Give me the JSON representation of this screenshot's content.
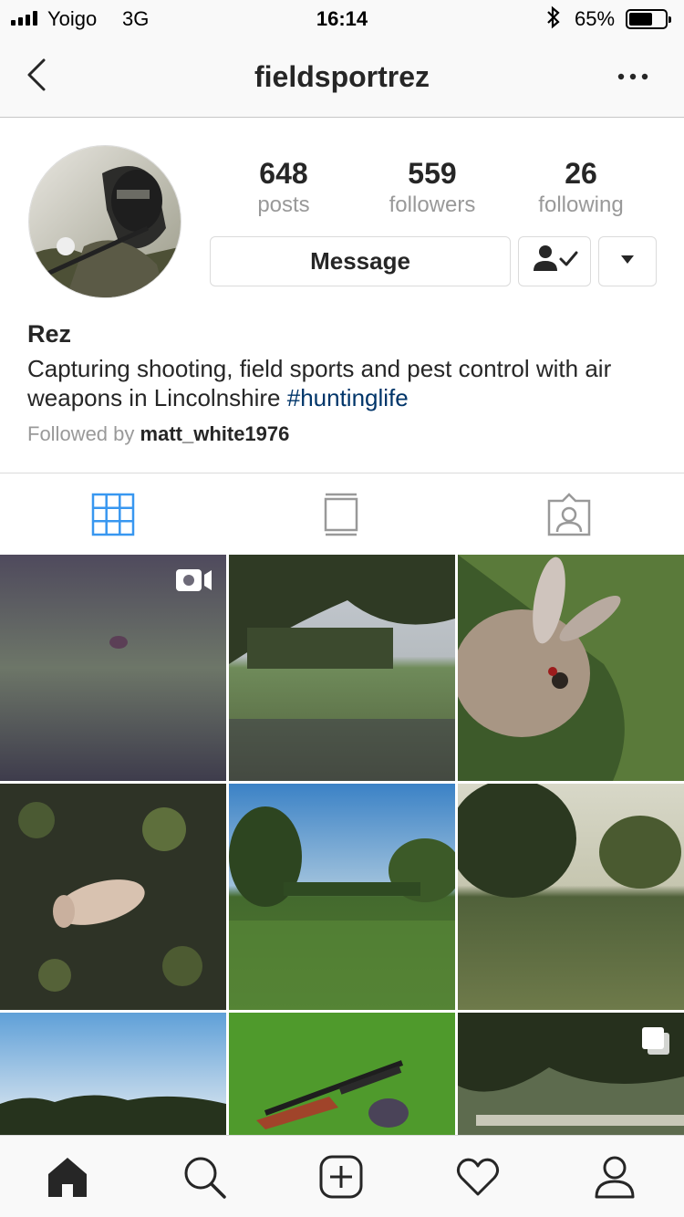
{
  "status_bar": {
    "carrier": "Yoigo",
    "network": "3G",
    "time": "16:14",
    "battery_percent": "65%",
    "battery_level": 0.65
  },
  "nav": {
    "title": "fieldsportrez",
    "back_icon": "chevron-left-icon",
    "more_icon": "more-horizontal-icon"
  },
  "profile": {
    "stats": [
      {
        "value": "648",
        "label": "posts"
      },
      {
        "value": "559",
        "label": "followers"
      },
      {
        "value": "26",
        "label": "following"
      }
    ],
    "message_label": "Message",
    "name": "Rez",
    "bio": "Capturing shooting, field sports and pest control with air weapons in Lincolnshire ",
    "hashtag": "#huntinglife",
    "followed_by_prefix": "Followed by ",
    "followed_by_user": "matt_white1976"
  },
  "tabs": [
    {
      "icon": "grid-icon",
      "active": true
    },
    {
      "icon": "feed-icon",
      "active": false
    },
    {
      "icon": "tagged-icon",
      "active": false
    }
  ],
  "posts": [
    {
      "subject": "grass field with small animal",
      "type": "video"
    },
    {
      "subject": "field framed by tree branches",
      "type": "photo"
    },
    {
      "subject": "dead rabbit in grass",
      "type": "photo"
    },
    {
      "subject": "dead rabbit in leaves",
      "type": "photo"
    },
    {
      "subject": "green meadow under blue sky",
      "type": "photo"
    },
    {
      "subject": "grass field with trees",
      "type": "photo"
    },
    {
      "subject": "sky and treeline",
      "type": "photo"
    },
    {
      "subject": "air rifle on grass",
      "type": "photo"
    },
    {
      "subject": "tree canopy and fence",
      "type": "carousel"
    }
  ],
  "tab_bar": [
    "home-icon",
    "search-icon",
    "new-post-icon",
    "activity-heart-icon",
    "profile-icon"
  ],
  "colors": {
    "accent_blue": "#3897f0",
    "hashtag": "#003569",
    "muted_text": "#999999",
    "bar_background": "#f9f9f9"
  }
}
